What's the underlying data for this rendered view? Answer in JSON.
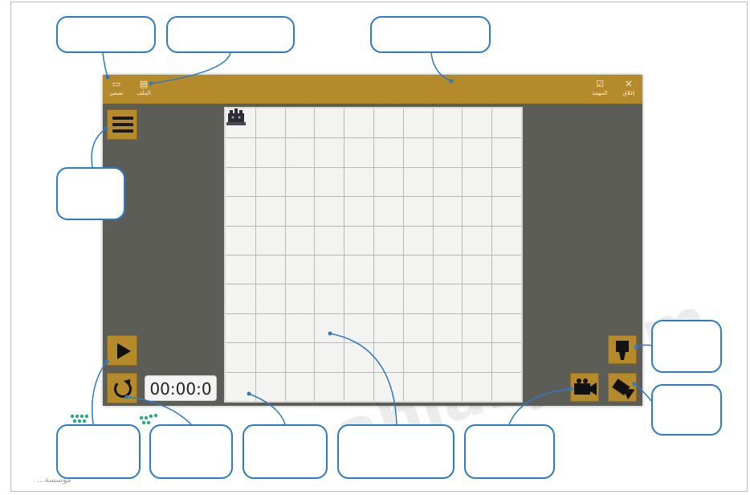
{
  "titlebar": {
    "left_buttons": [
      {
        "label": "تصغير",
        "icon": "window-icon"
      },
      {
        "label": "الملف",
        "icon": "file-icon"
      }
    ],
    "right_buttons": [
      {
        "label": "المهمة",
        "icon": "check-icon"
      },
      {
        "label": "إغلاق",
        "icon": "close-icon"
      }
    ]
  },
  "timer": {
    "value": "00:00:0"
  },
  "grid": {
    "rows": 10,
    "cols": 10
  },
  "colors": {
    "titlebar": "#b58a2b",
    "app_bg": "#5d5d58",
    "callout_border": "#2b7bc5",
    "grid_bg": "#f3f3f1"
  },
  "icons": [
    "menu-icon",
    "play-icon",
    "reset-icon",
    "robot-icon",
    "top-camera-icon",
    "side-camera-icon",
    "rotate-camera-icon"
  ],
  "watermark": "ahlahj.com",
  "footer_logo": "...مؤسسة"
}
